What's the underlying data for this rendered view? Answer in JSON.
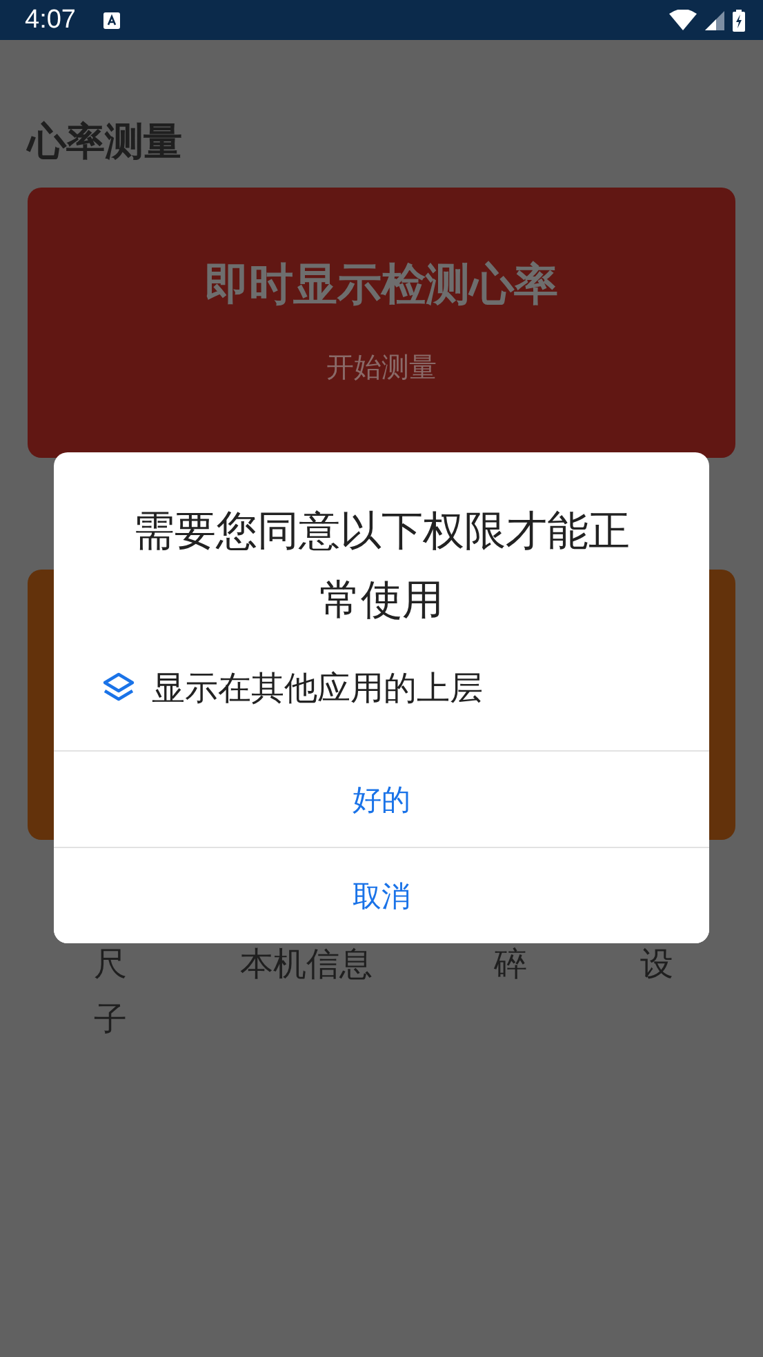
{
  "status_bar": {
    "time": "4:07"
  },
  "sections": [
    {
      "title": "心率测量",
      "card": {
        "title": "即时显示检测心率",
        "action": "开始测量",
        "color": "#611713"
      }
    },
    {
      "card": {
        "color": "#63320b"
      }
    }
  ],
  "tools": [
    {
      "label": "尺子"
    },
    {
      "label": "本机信息"
    },
    {
      "label": "碎"
    },
    {
      "label": "设"
    }
  ],
  "dialog": {
    "title": "需要您同意以下权限才能正常使用",
    "permissions": [
      {
        "label": "显示在其他应用的上层"
      }
    ],
    "buttons": [
      "好的",
      "取消"
    ]
  }
}
